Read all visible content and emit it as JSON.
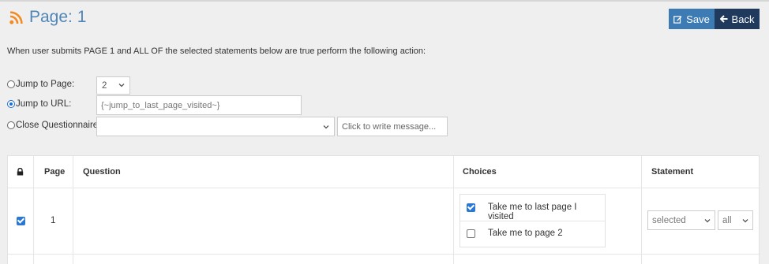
{
  "header": {
    "title": "Page: 1",
    "save_label": "Save",
    "back_label": "Back"
  },
  "instruction": "When user submits PAGE 1 and ALL OF the selected statements below are true perform the following action:",
  "actions": {
    "jump_page_label": "Jump to Page:",
    "jump_page_value": "2",
    "jump_url_label": "Jump to URL:",
    "jump_url_value": "{~jump_to_last_page_visited~}",
    "close_label": "Close Questionnaire.",
    "close_value": "",
    "message_placeholder": "Click to write message..."
  },
  "table": {
    "columns": [
      "",
      "Page",
      "Question",
      "Choices",
      "Statement"
    ],
    "rows": [
      {
        "checked": true,
        "page": "1",
        "question": "",
        "choices": [
          {
            "label": "Take me to last page I visited",
            "checked": true
          },
          {
            "label": "Take me to page 2",
            "checked": false
          }
        ],
        "statement": "selected",
        "scope": "all"
      }
    ]
  },
  "colors": {
    "accent": "#3d7bb5",
    "back": "#1f3a5c",
    "title": "#4f86b8",
    "rss": "#f28a22"
  }
}
